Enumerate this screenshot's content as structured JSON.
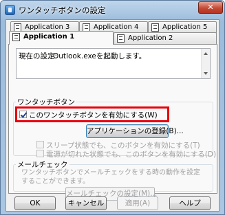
{
  "window": {
    "title": "ワンタッチボタンの設定",
    "close_label": "✕",
    "accent_color": "#e8000b"
  },
  "tabs": {
    "row_back": [
      {
        "label": "Application 3"
      },
      {
        "label": "Application 4"
      },
      {
        "label": "Application 5"
      }
    ],
    "row_front": [
      {
        "label": "Application 1",
        "active": true
      },
      {
        "label": "Application 2"
      }
    ]
  },
  "current": {
    "label": "現在の設定:",
    "value": "Outlook.exeを起動します。"
  },
  "onetouch_group": {
    "label": "ワンタッチボタン",
    "enable_checkbox": {
      "label": "このワンタッチボタンを有効にする(W)",
      "checked": true
    },
    "register_button": "アプリケーションの登録(B)...",
    "sleep_checkbox": {
      "label": "スリープ状態でも、このボタンを有効にする(T)",
      "checked": false
    },
    "poweroff_checkbox": {
      "label": "電源が切れた状態でも、このボタンを有効にする(D)",
      "checked": false
    }
  },
  "mail_group": {
    "label": "メールチェック",
    "description": "ワンタッチボタンでメールチェックをする時の動作を設定することができます。",
    "settings_button": "メールチェックの設定(M)..."
  },
  "footer": {
    "ok": "OK",
    "cancel": "キャンセル",
    "apply": "適用(A)",
    "help": "ヘルプ"
  }
}
